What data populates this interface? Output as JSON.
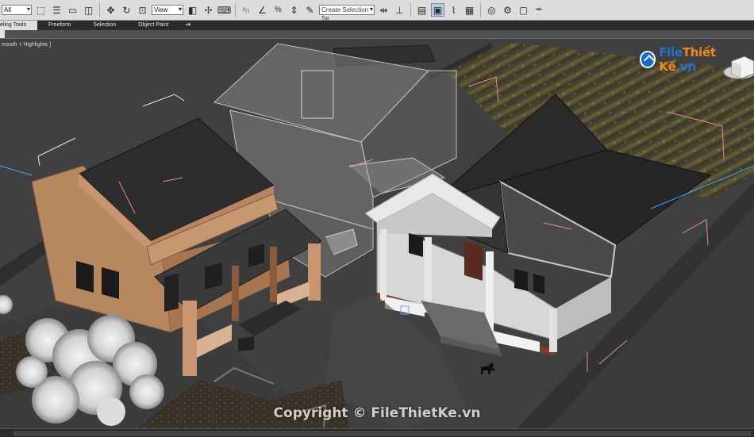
{
  "toolbar": {
    "filter_value": "All",
    "reference_value": "View",
    "selection_set_placeholder": "Create Selection Se",
    "icons": [
      "undo-icon",
      "select-object-icon",
      "select-by-name-icon",
      "rectangular-region-icon",
      "window-crossing-icon",
      "move-icon",
      "rotate-icon",
      "scale-icon",
      "reference-coordinate-icon",
      "pivot-icon",
      "select-manipulate-icon",
      "keyboard-shortcut-icon",
      "snaps-toggle-icon",
      "angle-snap-icon",
      "percent-snap-icon",
      "spinner-snap-icon",
      "edit-named-selection-icon",
      "mirror-icon",
      "align-icon",
      "toggle-layer-explorer-icon",
      "toggle-ribbon-icon",
      "curve-editor-icon",
      "schematic-view-icon",
      "material-editor-icon",
      "render-setup-icon",
      "rendered-frame-icon",
      "render-production-icon"
    ]
  },
  "ribbon": {
    "tabs": [
      "eling Tools",
      "Freeform",
      "Selection",
      "Object Paint"
    ],
    "active_tab": 0
  },
  "viewport": {
    "label": "mooth + Highlights ]"
  },
  "logo": {
    "text_main": "File",
    "text_accent": "Thiết Kế",
    "text_suffix": ".vn"
  },
  "watermark": "Copyright © FileThietKe.vn",
  "colors": {
    "toolbar_bg": "#dcdcdc",
    "ribbon_bg": "#2b2b2b",
    "viewport_bg": "#3f3f3f",
    "logo_blue": "#1e73d8",
    "logo_orange": "#f28a1a"
  }
}
